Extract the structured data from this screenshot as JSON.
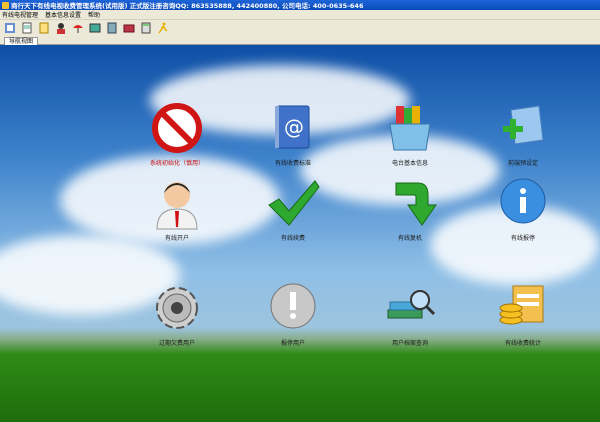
{
  "window": {
    "title": "商行天下有线电视收费管理系统(试用版) 正式版注册咨询QQ: 863535888, 442400880, 公司电话: 400-0635-646"
  },
  "menu": [
    "有线电视管理",
    "基本信息设置",
    "帮助"
  ],
  "toolbar": {
    "icons": [
      "settings-icon",
      "notepad-icon",
      "document-icon",
      "user-icon",
      "umbrella-icon",
      "picture-icon",
      "notebook-icon",
      "book-icon",
      "calculator-icon",
      "running-man-icon"
    ]
  },
  "tabs": {
    "active": "导航视图"
  },
  "desktop": {
    "items": [
      {
        "id": "init",
        "label": "系统初始化（慎用）",
        "icon": "prohibit-icon",
        "label_color": "#d01010"
      },
      {
        "id": "standard",
        "label": "有线收费标准",
        "icon": "at-book-icon"
      },
      {
        "id": "basic-info",
        "label": "电台基本信息",
        "icon": "box-files-icon"
      },
      {
        "id": "prepay",
        "label": "前端预设定",
        "icon": "add-folder-icon"
      },
      {
        "id": "open-account",
        "label": "有线开户",
        "icon": "user-avatar-icon"
      },
      {
        "id": "charge",
        "label": "有线续费",
        "icon": "checkmark-icon"
      },
      {
        "id": "reconnect",
        "label": "有线复机",
        "icon": "green-arrow-icon"
      },
      {
        "id": "report-stop",
        "label": "有线报停",
        "icon": "info-icon"
      },
      {
        "id": "expired-users",
        "label": "过期欠费用户",
        "icon": "gear-icon"
      },
      {
        "id": "stopped-users",
        "label": "报停用户",
        "icon": "exclamation-icon"
      },
      {
        "id": "user-archive",
        "label": "用户档案查询",
        "icon": "books-search-icon"
      },
      {
        "id": "statistics",
        "label": "有线收费统计",
        "icon": "coins-chart-icon"
      }
    ]
  }
}
